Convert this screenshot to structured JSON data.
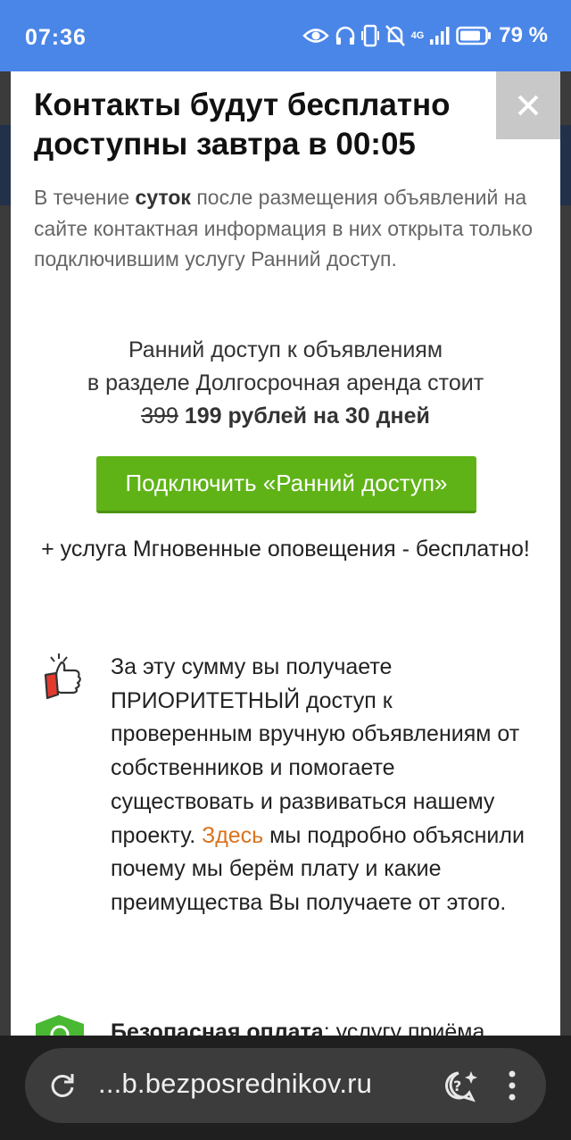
{
  "status_bar": {
    "time": "07:36",
    "network": "4G",
    "battery": "79 %",
    "icons": [
      "eye-icon",
      "headphones-icon",
      "vibrate-icon",
      "mute-bell-icon",
      "signal-icon",
      "battery-icon"
    ]
  },
  "modal": {
    "title_part1": "Контакты будут ",
    "title_part2": "бесплатно доступны завтра в 00:05",
    "intro_prefix": "В течение ",
    "intro_bold": "суток",
    "intro_rest": " после размещения объявлений на сайте контактная информация в них открыта только подключившим услугу Ранний доступ.",
    "price_line1": "Ранний доступ к объявлениям",
    "price_line2": "в разделе Долгосрочная аренда стоит",
    "price_old": "399",
    "price_new": "199 рублей на 30 дней",
    "cta_label": "Подключить «Ранний доступ»",
    "bonus_text": "+ услуга Мгновенные оповещения - бесплатно!",
    "desc_text": "За эту сумму вы получаете ПРИОРИТЕТНЫЙ доступ к проверенным вручную объявлениям от собственников и помогаете существовать и развиваться нашему проекту. ",
    "desc_link": "Здесь",
    "desc_rest": " мы подробно объяснили почему мы берём плату и какие преимущества Вы получаете от этого.",
    "secure_bold": "Безопасная оплата",
    "secure_rest": ": услугу приёма"
  },
  "browser": {
    "url": "...b.bezposrednikov.ru"
  },
  "colors": {
    "status_bar": "#4a86e8",
    "cta": "#5fb317",
    "link": "#d9731c",
    "close_bg": "#c8c8c8"
  }
}
